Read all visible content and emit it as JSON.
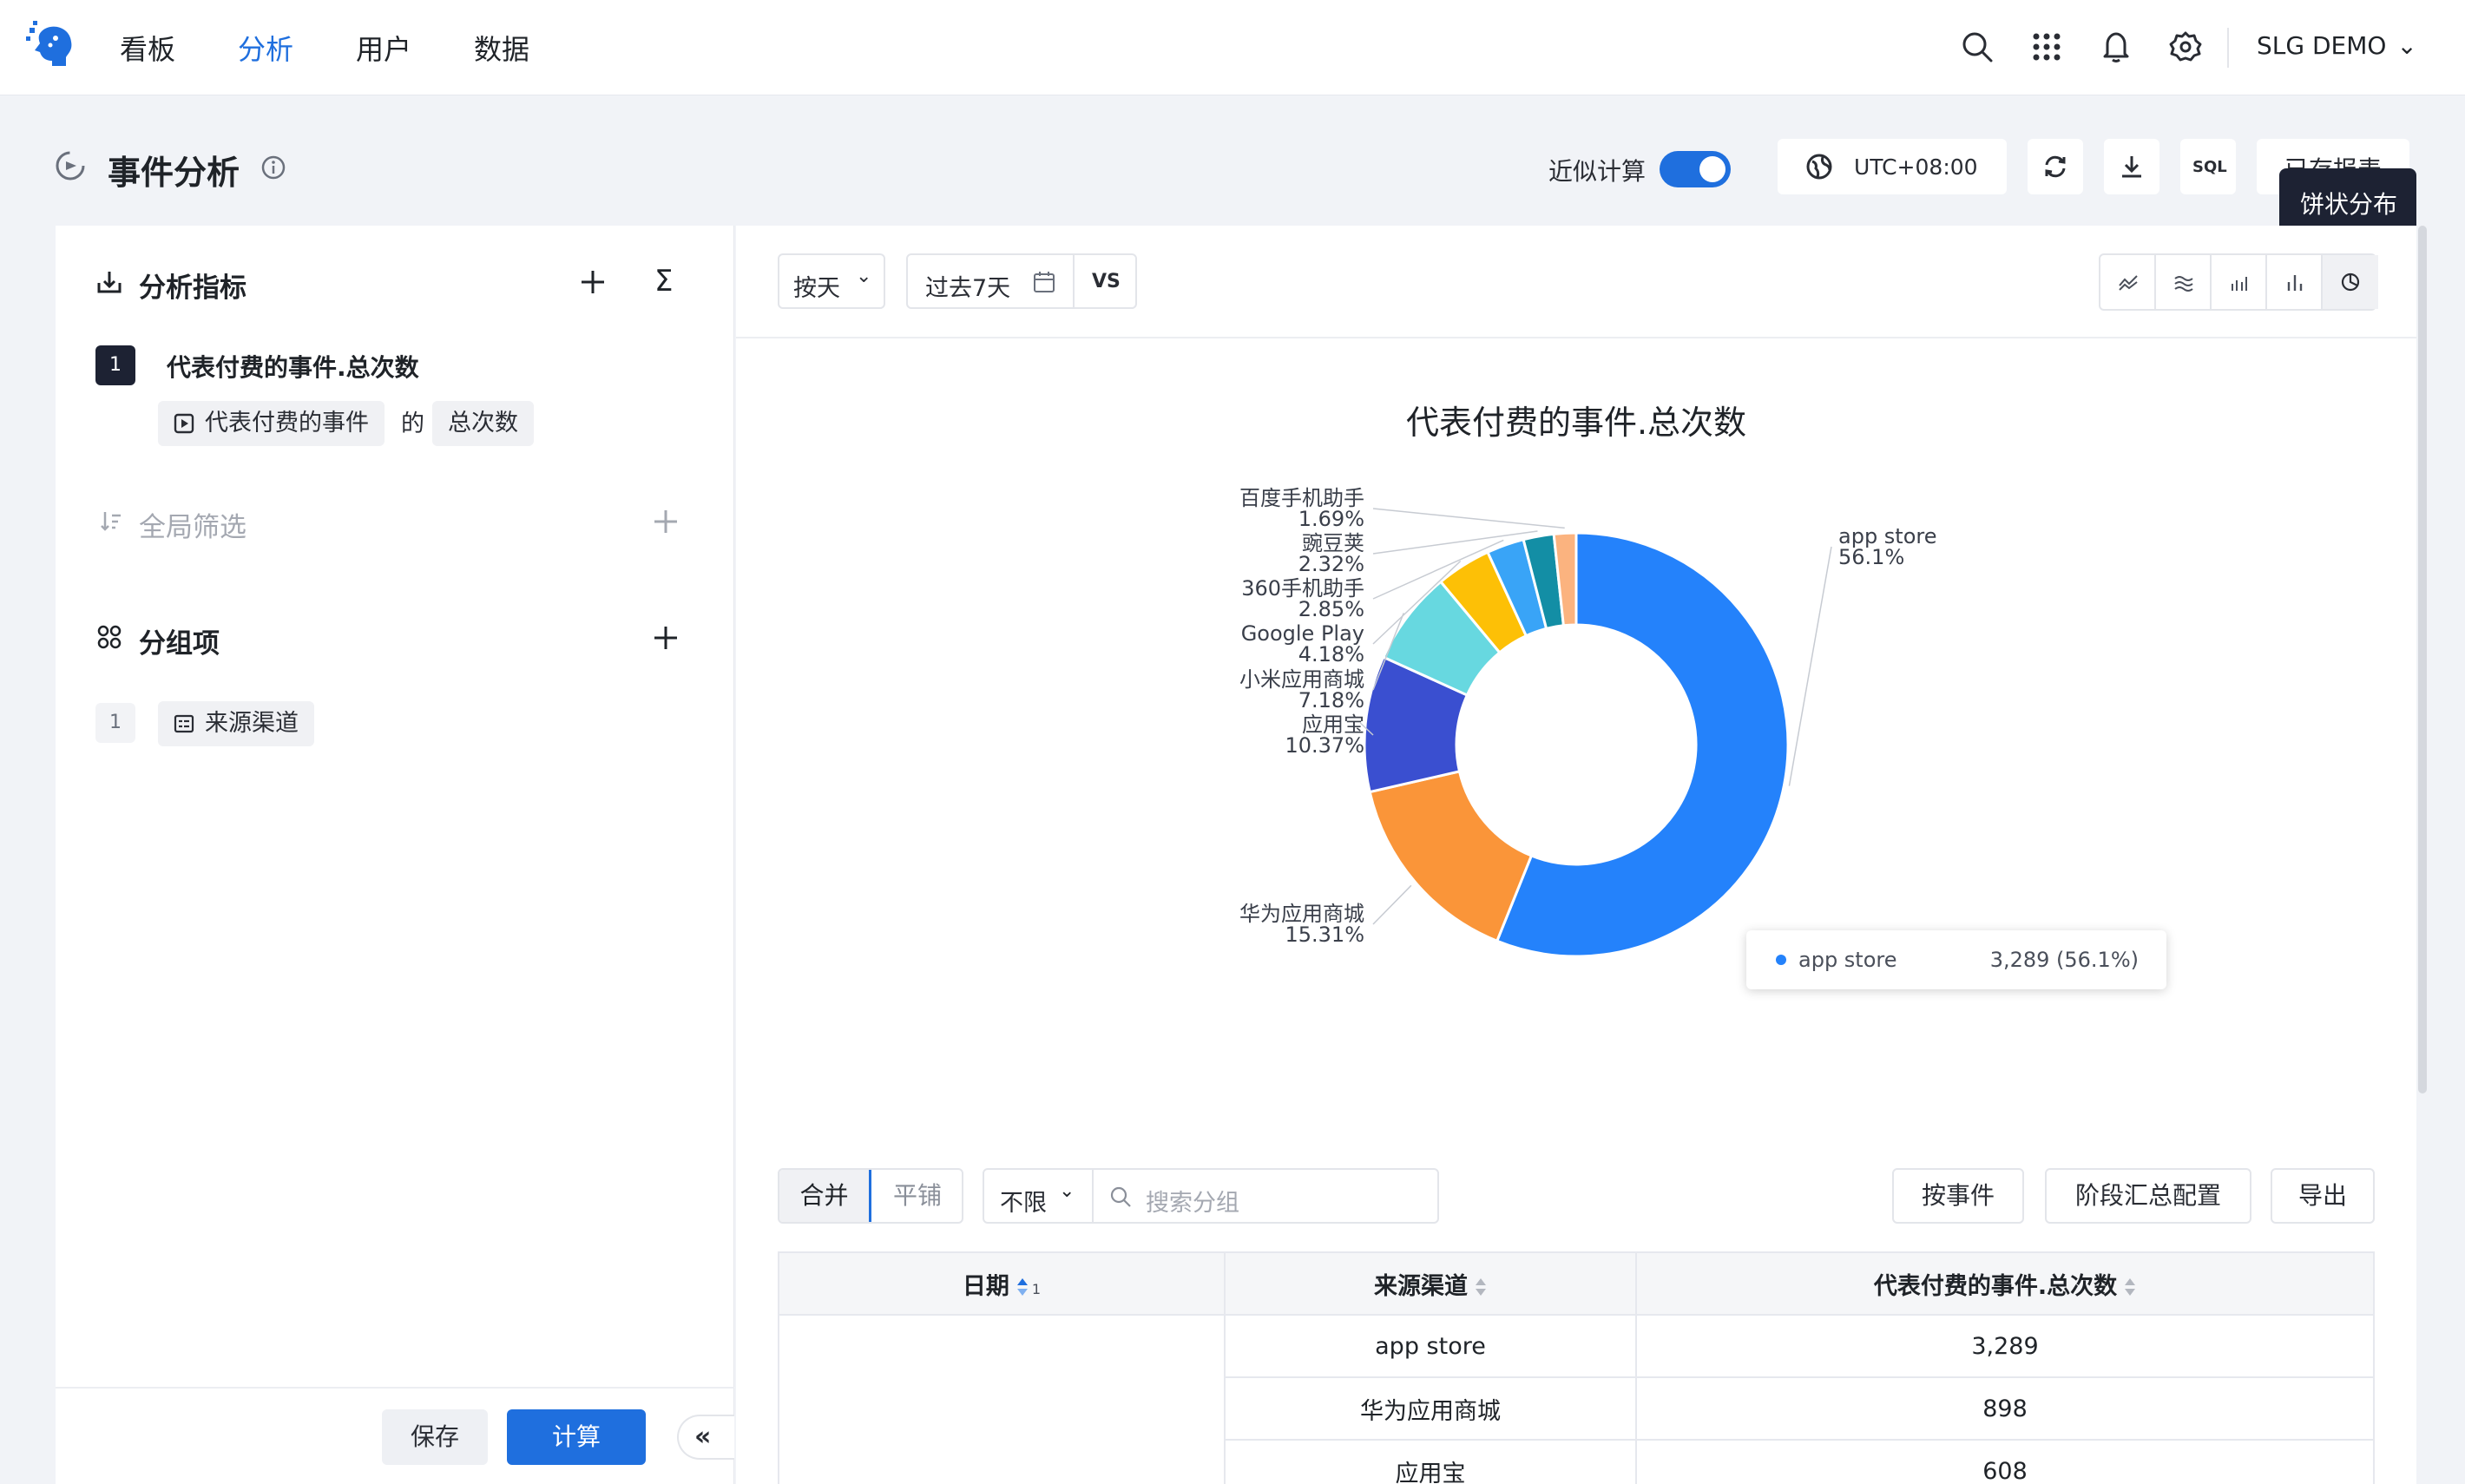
{
  "nav": {
    "items": [
      "看板",
      "分析",
      "用户",
      "数据"
    ],
    "active_index": 1,
    "user": "SLG DEMO"
  },
  "header": {
    "title": "事件分析",
    "approx_label": "近似计算",
    "approx_enabled": true,
    "timezone": "UTC+08:00",
    "sql_label": "SQL",
    "saved_report_label": "已存报表",
    "tooltip": "饼状分布"
  },
  "left": {
    "metrics_title": "分析指标",
    "sigma": "Σ",
    "metric_index": "1",
    "metric_name": "代表付费的事件.总次数",
    "metric_event_chip": "代表付费的事件",
    "metric_of": "的",
    "metric_agg_chip": "总次数",
    "filter_title": "全局筛选",
    "group_title": "分组项",
    "group_index": "1",
    "group_chip": "来源渠道",
    "save_label": "保存",
    "calc_label": "计算"
  },
  "toolbar": {
    "granularity": "按天",
    "date_range": "过去7天",
    "vs": "VS"
  },
  "chart_data": {
    "type": "pie",
    "title": "代表付费的事件.总次数",
    "donut": true,
    "series": [
      {
        "name": "app store",
        "percent": 56.1,
        "label_pct": "56.1%",
        "color": "#2482fb"
      },
      {
        "name": "华为应用商城",
        "percent": 15.31,
        "label_pct": "15.31%",
        "color": "#fa9539"
      },
      {
        "name": "应用宝",
        "percent": 10.37,
        "label_pct": "10.37%",
        "color": "#3a4fd0"
      },
      {
        "name": "小米应用商城",
        "percent": 7.18,
        "label_pct": "7.18%",
        "color": "#67d8e0"
      },
      {
        "name": "Google Play",
        "percent": 4.18,
        "label_pct": "4.18%",
        "color": "#fdc006"
      },
      {
        "name": "360手机助手",
        "percent": 2.85,
        "label_pct": "2.85%",
        "color": "#39a4f7"
      },
      {
        "name": "豌豆荚",
        "percent": 2.32,
        "label_pct": "2.32%",
        "color": "#138ea5"
      },
      {
        "name": "百度手机助手",
        "percent": 1.69,
        "label_pct": "1.69%",
        "color": "#fbb37f"
      }
    ],
    "hover": {
      "name": "app store",
      "value": "3,289 (56.1%)"
    }
  },
  "table_controls": {
    "merge": "合并",
    "tile": "平铺",
    "limit": "不限",
    "search_placeholder": "搜索分组",
    "by_event": "按事件",
    "stage_config": "阶段汇总配置",
    "export": "导出"
  },
  "table": {
    "headers": [
      "日期",
      "来源渠道",
      "代表付费的事件.总次数"
    ],
    "sort_index": "1",
    "rows": [
      {
        "date": "",
        "channel": "app store",
        "count": "3,289"
      },
      {
        "date": "",
        "channel": "华为应用商城",
        "count": "898"
      },
      {
        "date": "",
        "channel": "应用宝",
        "count": "608"
      }
    ]
  }
}
